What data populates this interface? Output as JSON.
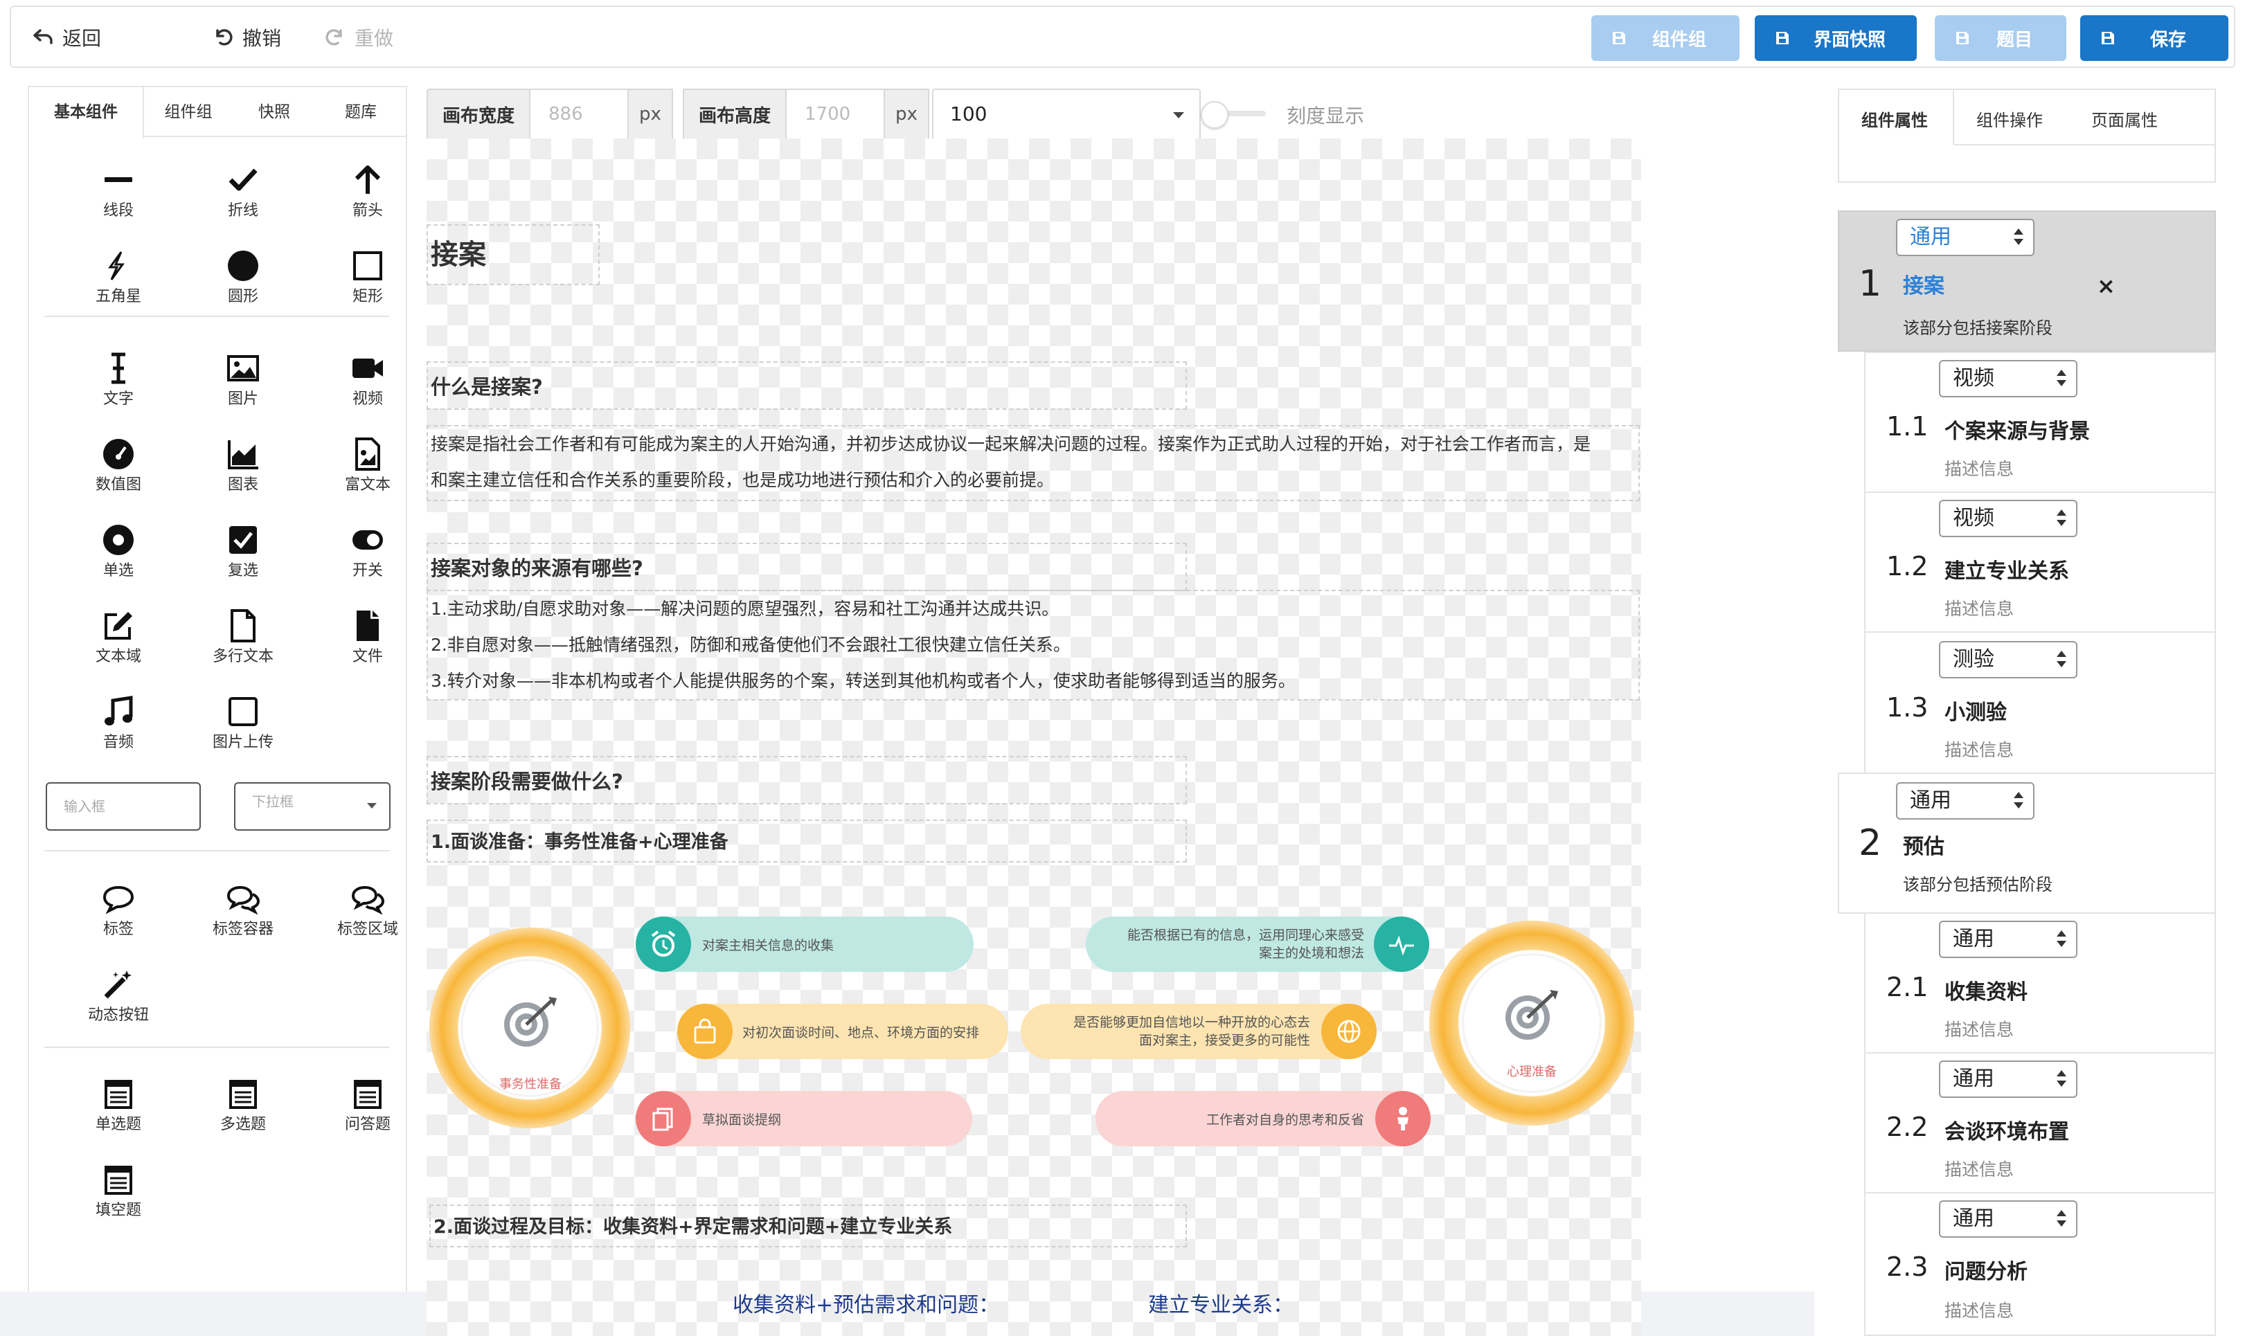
{
  "toolbar": {
    "back": "返回",
    "undo": "撤销",
    "redo": "重做",
    "component_group": "组件组",
    "screenshot": "界面快照",
    "question": "题目",
    "save": "保存"
  },
  "left_panel": {
    "tabs": [
      "基本组件",
      "组件组",
      "快照",
      "题库"
    ],
    "components": {
      "line": "线段",
      "polyline": "折线",
      "arrow": "箭头",
      "star": "五角星",
      "circle": "圆形",
      "rect": "矩形",
      "text": "文字",
      "image": "图片",
      "video": "视频",
      "gauge": "数值图",
      "chart": "图表",
      "richtext": "富文本",
      "radio": "单选",
      "checkbox": "复选",
      "switch": "开关",
      "textfield": "文本域",
      "multiline": "多行文本",
      "file": "文件",
      "audio": "音频",
      "upload": "图片上传",
      "tag": "标签",
      "tag_container": "标签容器",
      "tag_area": "标签区域",
      "dynamic_button": "动态按钮",
      "single_choice": "单选题",
      "multi_choice": "多选题",
      "qa": "问答题",
      "fill_blank": "填空题"
    },
    "input_placeholder": "输入框",
    "select_placeholder": "下拉框"
  },
  "canvas_toolbar": {
    "width_label": "画布宽度",
    "width_value": "886",
    "height_label": "画布高度",
    "height_value": "1700",
    "unit": "px",
    "zoom": "100",
    "scale_label": "刻度显示"
  },
  "canvas": {
    "title": "接案",
    "q1": "什么是接案?",
    "p1": [
      "接案是指社会工作者和有可能成为案主的人开始沟通，并初步达成协议一起来解决问题的过程。接案作为正式助人过程的开始，对于社会工作者而言，是",
      "和案主建立信任和合作关系的重要阶段，也是成功地进行预估和介入的必要前提。"
    ],
    "q2": "接案对象的来源有哪些?",
    "p2": [
      "1.主动求助/自愿求助对象——解决问题的愿望强烈，容易和社工沟通并达成共识。",
      "2.非自愿对象——抵触情绪强烈，防御和戒备使他们不会跟社工很快建立信任关系。",
      "3.转介对象——非本机构或者个人能提供服务的个案，转送到其他机构或者个人，使求助者能够得到适当的服务。"
    ],
    "q3": "接案阶段需要做什么?",
    "step1": "1.面谈准备：事务性准备+心理准备",
    "left_ring_label": "事务性准备",
    "right_ring_label": "心理准备",
    "pills_left": [
      "对案主相关信息的收集",
      "对初次面谈时间、地点、环境方面的安排",
      "草拟面谈提纲"
    ],
    "pills_right_1a": "能否根据已有的信息，运用同理心来感受",
    "pills_right_1b": "案主的处境和想法",
    "pills_right_2a": "是否能够更加自信地以一种开放的心态去",
    "pills_right_2b": "面对案主，接受更多的可能性",
    "pills_right_3": "工作者对自身的思考和反省",
    "step2": "2.面谈过程及目标：收集资料+界定需求和问题+建立专业关系",
    "bottom_left": "收集资料+预估需求和问题：",
    "bottom_right": "建立专业关系："
  },
  "right_panel": {
    "tabs": [
      "组件属性",
      "组件操作",
      "页面属性"
    ],
    "sections": [
      {
        "num": "1",
        "type": "通用",
        "title": "接案",
        "desc": "该部分包括接案阶段"
      },
      {
        "num": "1.1",
        "type": "视频",
        "title": "个案来源与背景",
        "desc": "描述信息"
      },
      {
        "num": "1.2",
        "type": "视频",
        "title": "建立专业关系",
        "desc": "描述信息"
      },
      {
        "num": "1.3",
        "type": "测验",
        "title": "小测验",
        "desc": "描述信息"
      },
      {
        "num": "2",
        "type": "通用",
        "title": "预估",
        "desc": "该部分包括预估阶段"
      },
      {
        "num": "2.1",
        "type": "通用",
        "title": "收集资料",
        "desc": "描述信息"
      },
      {
        "num": "2.2",
        "type": "通用",
        "title": "会谈环境布置",
        "desc": "描述信息"
      },
      {
        "num": "2.3",
        "type": "通用",
        "title": "问题分析",
        "desc": "描述信息"
      }
    ],
    "close_glyph": "×"
  },
  "colors": {
    "primary": "#1976c8",
    "primary_light": "#a8cdf0",
    "ring_orange": "#f8b63a",
    "teal": "#27b3a4",
    "pink": "#f07b7b"
  }
}
